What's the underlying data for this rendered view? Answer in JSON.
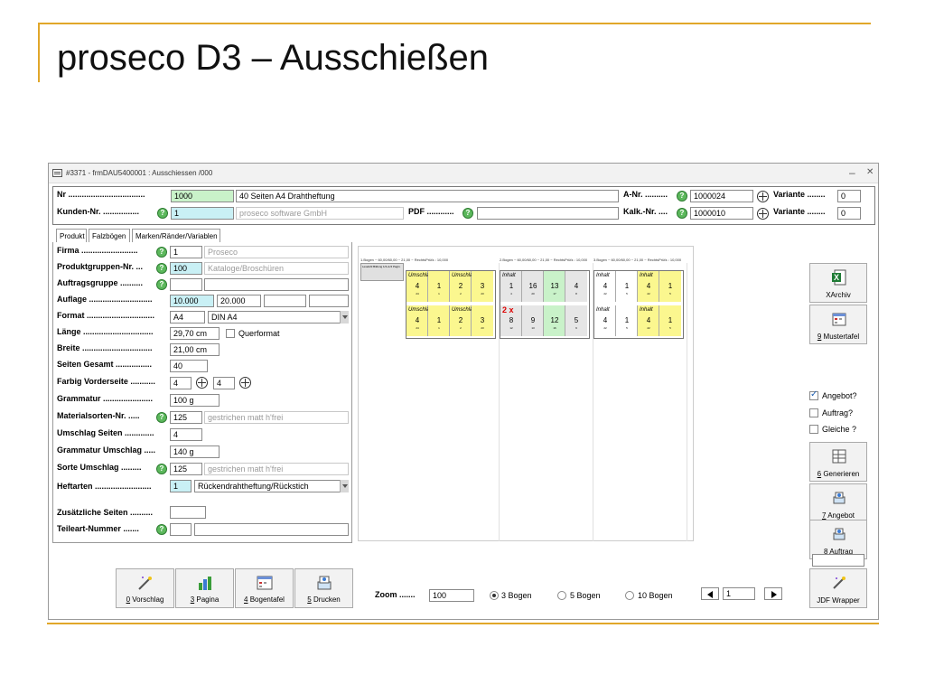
{
  "slide": {
    "title": "proseco D3 – Ausschießen"
  },
  "window": {
    "title": "#3371 - frmDAU5400001 : Ausschiessen /000",
    "minimize": "–",
    "close": "✕"
  },
  "header": {
    "nr_label": "Nr ..................................",
    "nr_value": "1000",
    "nr_desc": "40 Seiten A4 Drahtheftung",
    "kunden_label": "Kunden-Nr. ................",
    "kunden_value": "1",
    "kunden_name": "proseco software GmbH",
    "pdf_label": "PDF ............",
    "pdf_value": "",
    "anr_label": "A-Nr. ..........",
    "anr_value": "1000024",
    "kalk_label": "Kalk.-Nr. ....",
    "kalk_value": "1000010",
    "variante_label": "Variante ........",
    "variante1": "0",
    "variante2": "0"
  },
  "tabs": [
    "Produkt",
    "Falzbögen",
    "Marken/Ränder/Variablen"
  ],
  "form": {
    "firma_label": "Firma .........................",
    "firma_value": "1",
    "firma_name": "Proseco",
    "pg_label": "Produktgruppen-Nr. ...",
    "pg_value": "100",
    "pg_name": "Kataloge/Broschüren",
    "ag_label": "Auftragsgruppe ..........",
    "auflage_label": "Auflage ............................",
    "auflage1": "10.000",
    "auflage2": "20.000",
    "format_label": "Format ..............................",
    "format_value": "A4",
    "format_name": "DIN A4",
    "laenge_label": "Länge ...............................",
    "laenge_value": "29,70 cm",
    "querformat": "Querformat",
    "breite_label": "Breite ...............................",
    "breite_value": "21,00 cm",
    "seiten_label": "Seiten Gesamt ................",
    "seiten_value": "40",
    "farbig_label": "Farbig Vorderseite ...........",
    "farbig1": "4",
    "farbig2": "4",
    "grammatur_label": "Grammatur ......................",
    "grammatur_value": "100 g",
    "material_label": "Materialsorten-Nr. .....",
    "material_value": "125",
    "material_name": "gestrichen matt h'frei",
    "us_label": "Umschlag Seiten .............",
    "us_value": "4",
    "gu_label": "Grammatur Umschlag .....",
    "gu_value": "140 g",
    "su_label": "Sorte Umschlag .........",
    "su_value": "125",
    "su_name": "gestrichen matt h'frei",
    "heft_label": "Heftarten .........................",
    "heft_value": "1",
    "heft_name": "Rückendrahtheftung/Rückstich",
    "zus_label": "Zusätzliche Seiten ..........",
    "teil_label": "Teileart-Nummer ......."
  },
  "preview": {
    "headers": [
      "1.Bogen ~ 60,00/60,00 ~ 21,00 ~ RechtsPrüfz.: 10,000",
      "2.Bogen ~ 60,00/60,00 ~ 21,00 ~ RechtsPrüfz.: 10,000",
      "3.Bogen ~ 60,00/60,00 ~ 21,00 ~ RechtsPrüfz.: 10,000"
    ],
    "note": "Lesefehl Bildung 1/4+1/4 Pagin.",
    "times": "2 x",
    "umschlag": "Umschlag",
    "inhalt": "Inhalt"
  },
  "side": {
    "xarchiv": "XArchiv",
    "mustertafel_key": "9",
    "mustertafel": " Mustertafel",
    "angebot_chk": "Angebot?",
    "auftrag_chk": "Auftrag?",
    "gleiche_chk": "Gleiche ?",
    "generieren_key": "6",
    "generieren": " Generieren",
    "angebot_key": "7",
    "angebot": " Angebot",
    "auftrag_key": "8",
    "auftrag": " Auftrag",
    "jdf": "JDF Wrapper"
  },
  "bottom": {
    "vorschlag_key": "0",
    "vorschlag": " Vorschlag",
    "pagina_key": "3",
    "pagina": " Pagina",
    "bogentafel_key": "4",
    "bogentafel": " Bogentafel",
    "drucken_key": "5",
    "drucken": " Drucken",
    "zoom_label": "Zoom .......",
    "zoom_value": "100",
    "r3": "3 Bogen",
    "r5": "5 Bogen",
    "r10": "10 Bogen",
    "page": "1"
  }
}
